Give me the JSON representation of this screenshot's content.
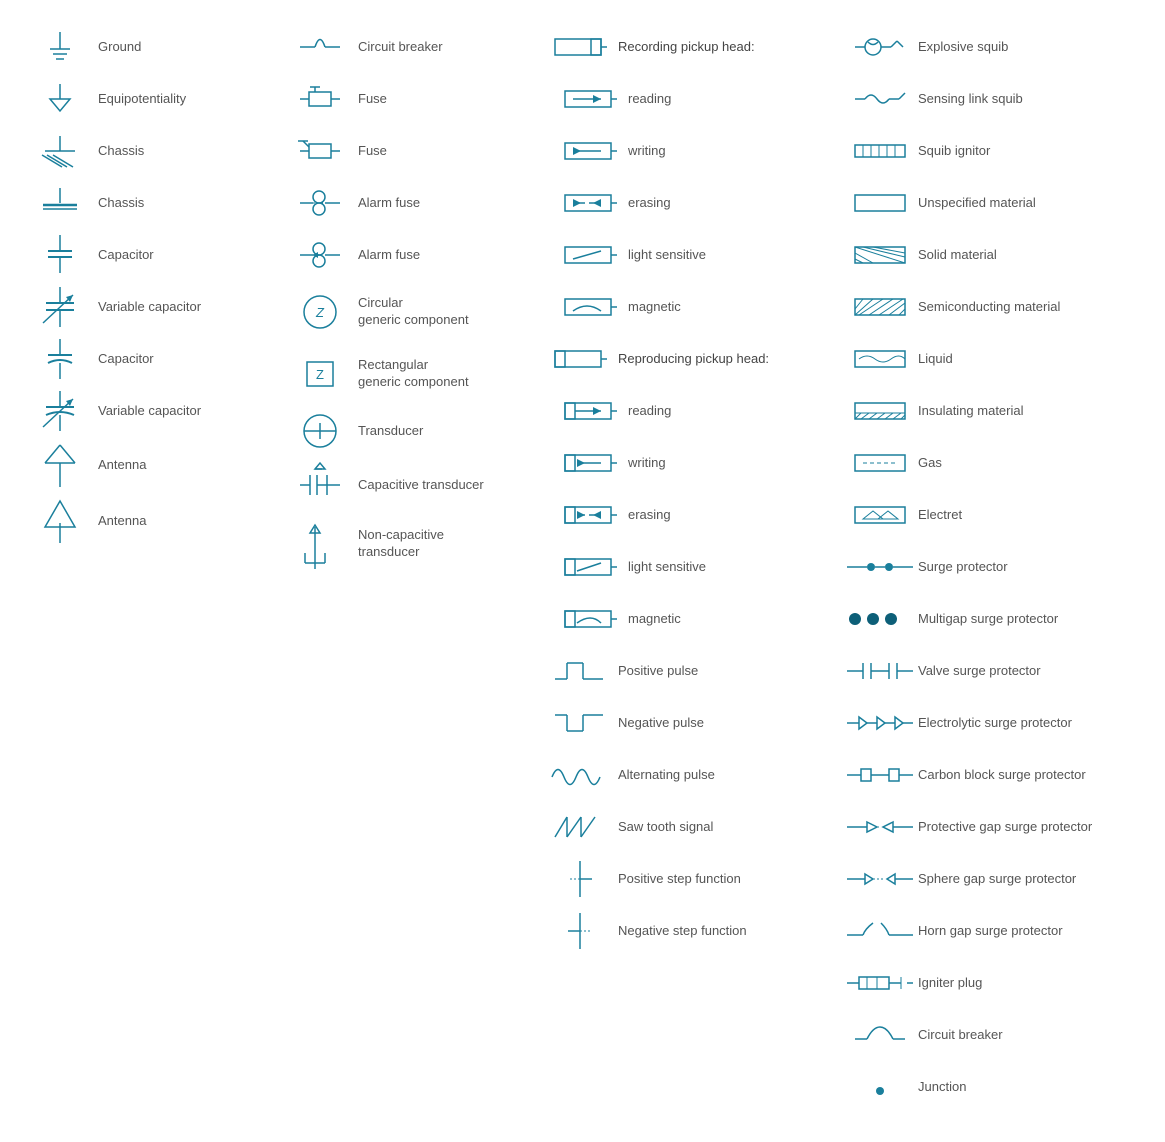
{
  "col1": [
    {
      "label": "Ground"
    },
    {
      "label": "Equipotentiality"
    },
    {
      "label": "Chassis"
    },
    {
      "label": "Chassis"
    },
    {
      "label": "Capacitor"
    },
    {
      "label": "Variable capacitor"
    },
    {
      "label": "Capacitor"
    },
    {
      "label": "Variable capacitor"
    },
    {
      "label": "Antenna"
    },
    {
      "label": "Antenna"
    }
  ],
  "col2": [
    {
      "label": "Circuit breaker"
    },
    {
      "label": "Fuse"
    },
    {
      "label": "Fuse"
    },
    {
      "label": "Alarm fuse"
    },
    {
      "label": "Alarm fuse"
    },
    {
      "label": "Circular\ngeneric component"
    },
    {
      "label": "Rectangular\ngeneric component"
    },
    {
      "label": "Transducer"
    },
    {
      "label": "Capacitive transducer"
    },
    {
      "label": "Non-capacitive\ntransducer"
    }
  ],
  "col3": [
    {
      "label": "Recording pickup head:"
    },
    {
      "label": "reading"
    },
    {
      "label": "writing"
    },
    {
      "label": "erasing"
    },
    {
      "label": "light sensitive"
    },
    {
      "label": "magnetic"
    },
    {
      "label": "Reproducing pickup head:"
    },
    {
      "label": "reading"
    },
    {
      "label": "writing"
    },
    {
      "label": "erasing"
    },
    {
      "label": "light sensitive"
    },
    {
      "label": "magnetic"
    },
    {
      "label": "Positive pulse"
    },
    {
      "label": "Negative pulse"
    },
    {
      "label": "Alternating pulse"
    },
    {
      "label": "Saw tooth signal"
    },
    {
      "label": "Positive step function"
    },
    {
      "label": "Negative step function"
    }
  ],
  "col4": [
    {
      "label": "Explosive squib"
    },
    {
      "label": "Sensing link squib"
    },
    {
      "label": "Squib ignitor"
    },
    {
      "label": "Unspecified material"
    },
    {
      "label": "Solid material"
    },
    {
      "label": "Semiconducting material"
    },
    {
      "label": "Liquid"
    },
    {
      "label": "Insulating material"
    },
    {
      "label": "Gas"
    },
    {
      "label": "Electret"
    },
    {
      "label": "Surge protector"
    },
    {
      "label": "Multigap surge protector"
    },
    {
      "label": "Valve surge protector"
    },
    {
      "label": "Electrolytic surge protector"
    },
    {
      "label": "Carbon block surge protector"
    },
    {
      "label": "Protective gap surge protector"
    },
    {
      "label": "Sphere gap surge protector"
    },
    {
      "label": "Horn gap surge protector"
    },
    {
      "label": "Igniter plug"
    },
    {
      "label": "Circuit breaker"
    },
    {
      "label": "Junction"
    }
  ]
}
